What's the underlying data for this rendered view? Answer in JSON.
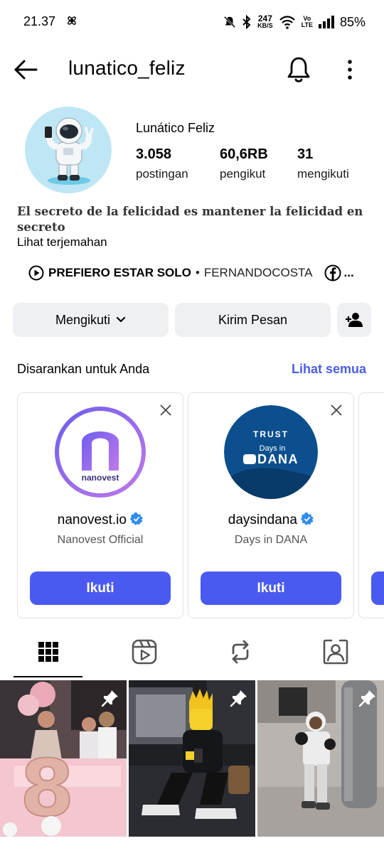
{
  "status_bar": {
    "time": "21.37",
    "speed_value": "247",
    "speed_unit": "KB/S",
    "volte_top": "Vo",
    "volte_bottom": "LTE",
    "battery": "85%"
  },
  "header": {
    "username": "lunatico_feliz"
  },
  "profile": {
    "display_name": "Lunático Feliz",
    "stats": [
      {
        "value": "3.058",
        "label": "postingan"
      },
      {
        "value": "60,6RB",
        "label": "pengikut"
      },
      {
        "value": "31",
        "label": "mengikuti"
      }
    ],
    "bio": "El secreto de la felicidad es mantener la felicidad en secreto",
    "translate_link": "Lihat terjemahan",
    "music_song": "PREFIERO ESTAR SOLO",
    "music_separator": "•",
    "music_artist": "FERNANDOCOSTA",
    "music_more": "..."
  },
  "actions": {
    "following_label": "Mengikuti",
    "message_label": "Kirim Pesan"
  },
  "suggestions": {
    "title": "Disarankan untuk Anda",
    "see_all": "Lihat semua",
    "cards": [
      {
        "handle": "nanovest.io",
        "name": "Nanovest Official",
        "logo_text": "nanovest",
        "follow_label": "Ikuti"
      },
      {
        "handle": "daysindana",
        "name": "Days in DANA",
        "logo_line1": "TRUST",
        "logo_line2": "Days in",
        "logo_line3": "DANA",
        "follow_label": "Ikuti"
      }
    ]
  },
  "tabs": [
    "grid-icon",
    "reels-icon",
    "reposts-icon",
    "tagged-icon"
  ],
  "colors": {
    "accent": "#4a5af0",
    "link": "#4a5ee8",
    "button_grey": "#eff0f4",
    "avatar_bg": "#bfe6f5"
  }
}
